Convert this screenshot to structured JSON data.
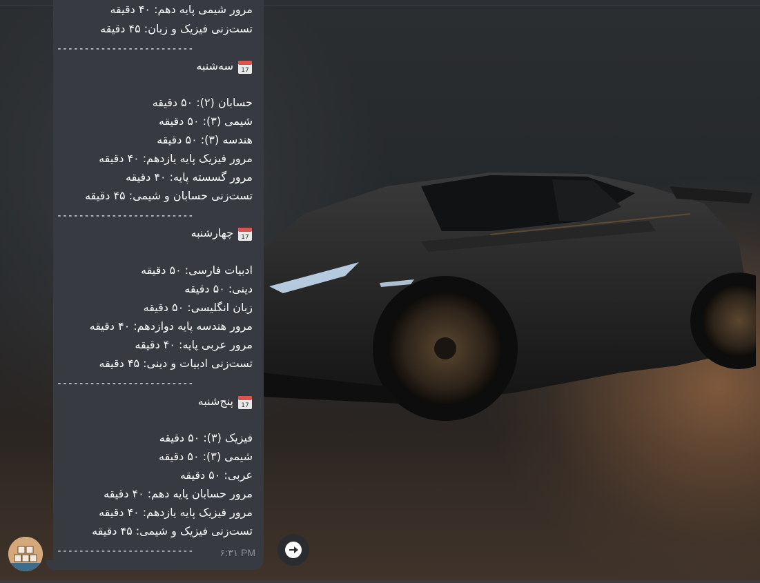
{
  "message": {
    "lines": [
      "مرور شیمی پایه دهم: ۴۰ دقیقه",
      "تست‌زنی فیزیک و زبان: ۴۵ دقیقه",
      "-------------------------",
      "سه‌شنبه",
      "",
      "حسابان (۲): ۵۰ دقیقه",
      "شیمی (۳): ۵۰ دقیقه",
      "هندسه (۳): ۵۰ دقیقه",
      "مرور فیزیک پایه یازدهم: ۴۰ دقیقه",
      "مرور گسسته پایه: ۴۰ دقیقه",
      "تست‌زنی حسابان و شیمی: ۴۵ دقیقه",
      "-------------------------",
      "چهارشنبه",
      "",
      "ادبیات فارسی: ۵۰ دقیقه",
      "دینی: ۵۰ دقیقه",
      "زبان انگلیسی: ۵۰ دقیقه",
      "مرور هندسه پایه دوازدهم: ۴۰ دقیقه",
      "مرور عربی پایه: ۴۰ دقیقه",
      "تست‌زنی ادبیات و دینی: ۴۵ دقیقه",
      "-------------------------",
      "پنج‌شنبه",
      "",
      "فیزیک (۳): ۵۰ دقیقه",
      "شیمی (۳): ۵۰ دقیقه",
      "عربی: ۵۰ دقیقه",
      "مرور حسابان پایه دهم: ۴۰ دقیقه",
      "مرور فیزیک پایه یازدهم: ۴۰ دقیقه",
      "تست‌زنی فیزیک و شیمی: ۴۵ دقیقه",
      "-------------------------"
    ],
    "time": "۶:۳۱ PM",
    "calendar_icon": "calendar-icon"
  },
  "actions": {
    "share_icon": "share-forward-icon"
  },
  "colors": {
    "bubble": "#373b41",
    "text": "#ffffff",
    "time": "#8b939c"
  }
}
